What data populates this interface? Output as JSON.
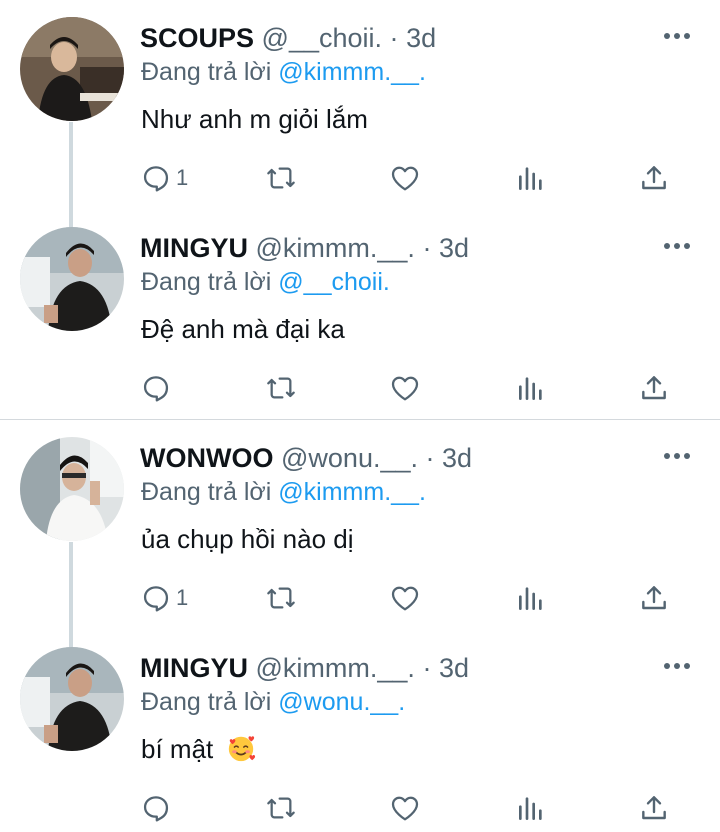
{
  "tweets": [
    {
      "name": "SCOUPS",
      "handle": "@__choii.",
      "dot": "·",
      "time": "3d",
      "reply_prefix": "Đang trả lời",
      "reply_to": "@kimmm.__.",
      "text": "Như anh m giỏi lắm",
      "reply_count": "1",
      "avatar_icon": "profile-photo"
    },
    {
      "name": "MINGYU",
      "handle": "@kimmm.__.",
      "dot": "·",
      "time": "3d",
      "reply_prefix": "Đang trả lời",
      "reply_to": "@__choii.",
      "text": "Đệ anh mà đại ka",
      "reply_count": "",
      "avatar_icon": "profile-photo"
    },
    {
      "name": "WONWOO",
      "handle": "@wonu.__.",
      "dot": "·",
      "time": "3d",
      "reply_prefix": "Đang trả lời",
      "reply_to": "@kimmm.__.",
      "text": "ủa chụp hồi nào dị",
      "reply_count": "1",
      "avatar_icon": "profile-photo"
    },
    {
      "name": "MINGYU",
      "handle": "@kimmm.__.",
      "dot": "·",
      "time": "3d",
      "reply_prefix": "Đang trả lời",
      "reply_to": "@wonu.__.",
      "text": "bí mật",
      "reply_count": "",
      "emoji": "smiling-face-with-hearts"
    }
  ],
  "colors": {
    "text": "#0f1419",
    "secondary": "#536471",
    "link": "#1d9bf0",
    "thread_line": "#cfd9de"
  }
}
